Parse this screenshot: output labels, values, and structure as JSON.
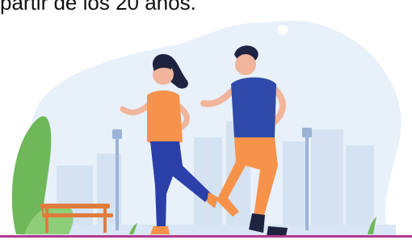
{
  "caption": {
    "text": "partir de los 20 años."
  },
  "illustration": {
    "subject": "couple jogging in a city park",
    "colors": {
      "background_blob": "#e6eef8",
      "city": "#d4e2f2",
      "woman_shirt": "#f7924a",
      "woman_pants": "#2b3fa8",
      "man_shirt": "#2f4aa8",
      "man_pants": "#f7924a",
      "skin": "#f0b59a",
      "hair": "#1e2340",
      "bench": "#e07b3b",
      "lamp": "#9bb3d6",
      "bush": "#6fb85a",
      "ground": "#d9e6f5",
      "divider": "#b03a8e"
    }
  }
}
